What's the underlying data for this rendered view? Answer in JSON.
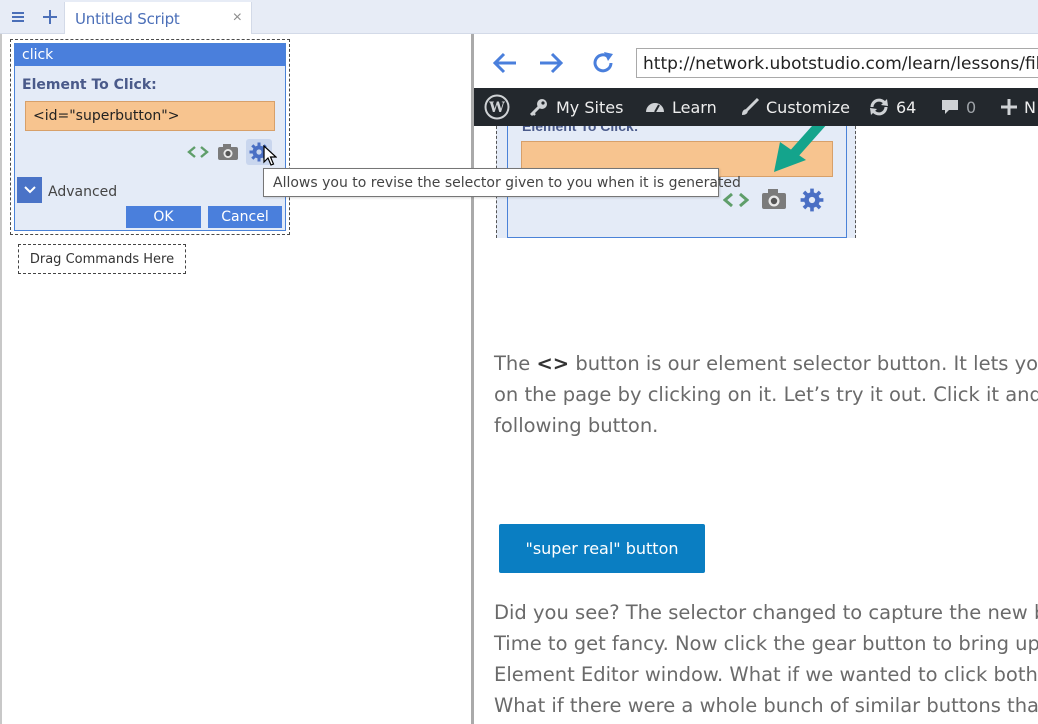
{
  "tabbar": {
    "tab_title": "Untitled Script",
    "close_glyph": "×"
  },
  "command": {
    "header": "click",
    "field_label": "Element To Click:",
    "field_value": "<id=\"superbutton\">",
    "advanced_label": "Advanced",
    "ok_label": "OK",
    "cancel_label": "Cancel",
    "drag_label": "Drag Commands Here"
  },
  "tooltip": {
    "text": "Allows you to revise the selector given to you when it is generated"
  },
  "browser": {
    "url": "http://network.ubotstudio.com/learn/lessons/filling-"
  },
  "wpbar": {
    "my_sites": "My Sites",
    "learn": "Learn",
    "customize": "Customize",
    "updates_count": "64",
    "comments_count": "0",
    "new_label": "N"
  },
  "lesson_image": {
    "label": "Element To Click:"
  },
  "page": {
    "para1_pre": "The ",
    "para1_bold": "<>",
    "para1_line1": " button is our element selector button. It lets you ch",
    "para1_line2": "on the page by clicking on it. Let’s try it out. Click it and the",
    "para1_line3": "following button.",
    "super_button": "\"super real\" button",
    "para2_line1": "Did you see? The selector changed to capture the new butt",
    "para2_line2": "Time to get fancy. Now click the gear button to bring up the",
    "para2_line3": "Element Editor window. What if we wanted to click both bu",
    "para2_line4": "What if there were a whole bunch of similar buttons that n"
  },
  "colors": {
    "accent": "#4a7fdc",
    "field": "#f7c48f",
    "wp_bar": "#23282d",
    "page_button": "#0a7ec2"
  }
}
